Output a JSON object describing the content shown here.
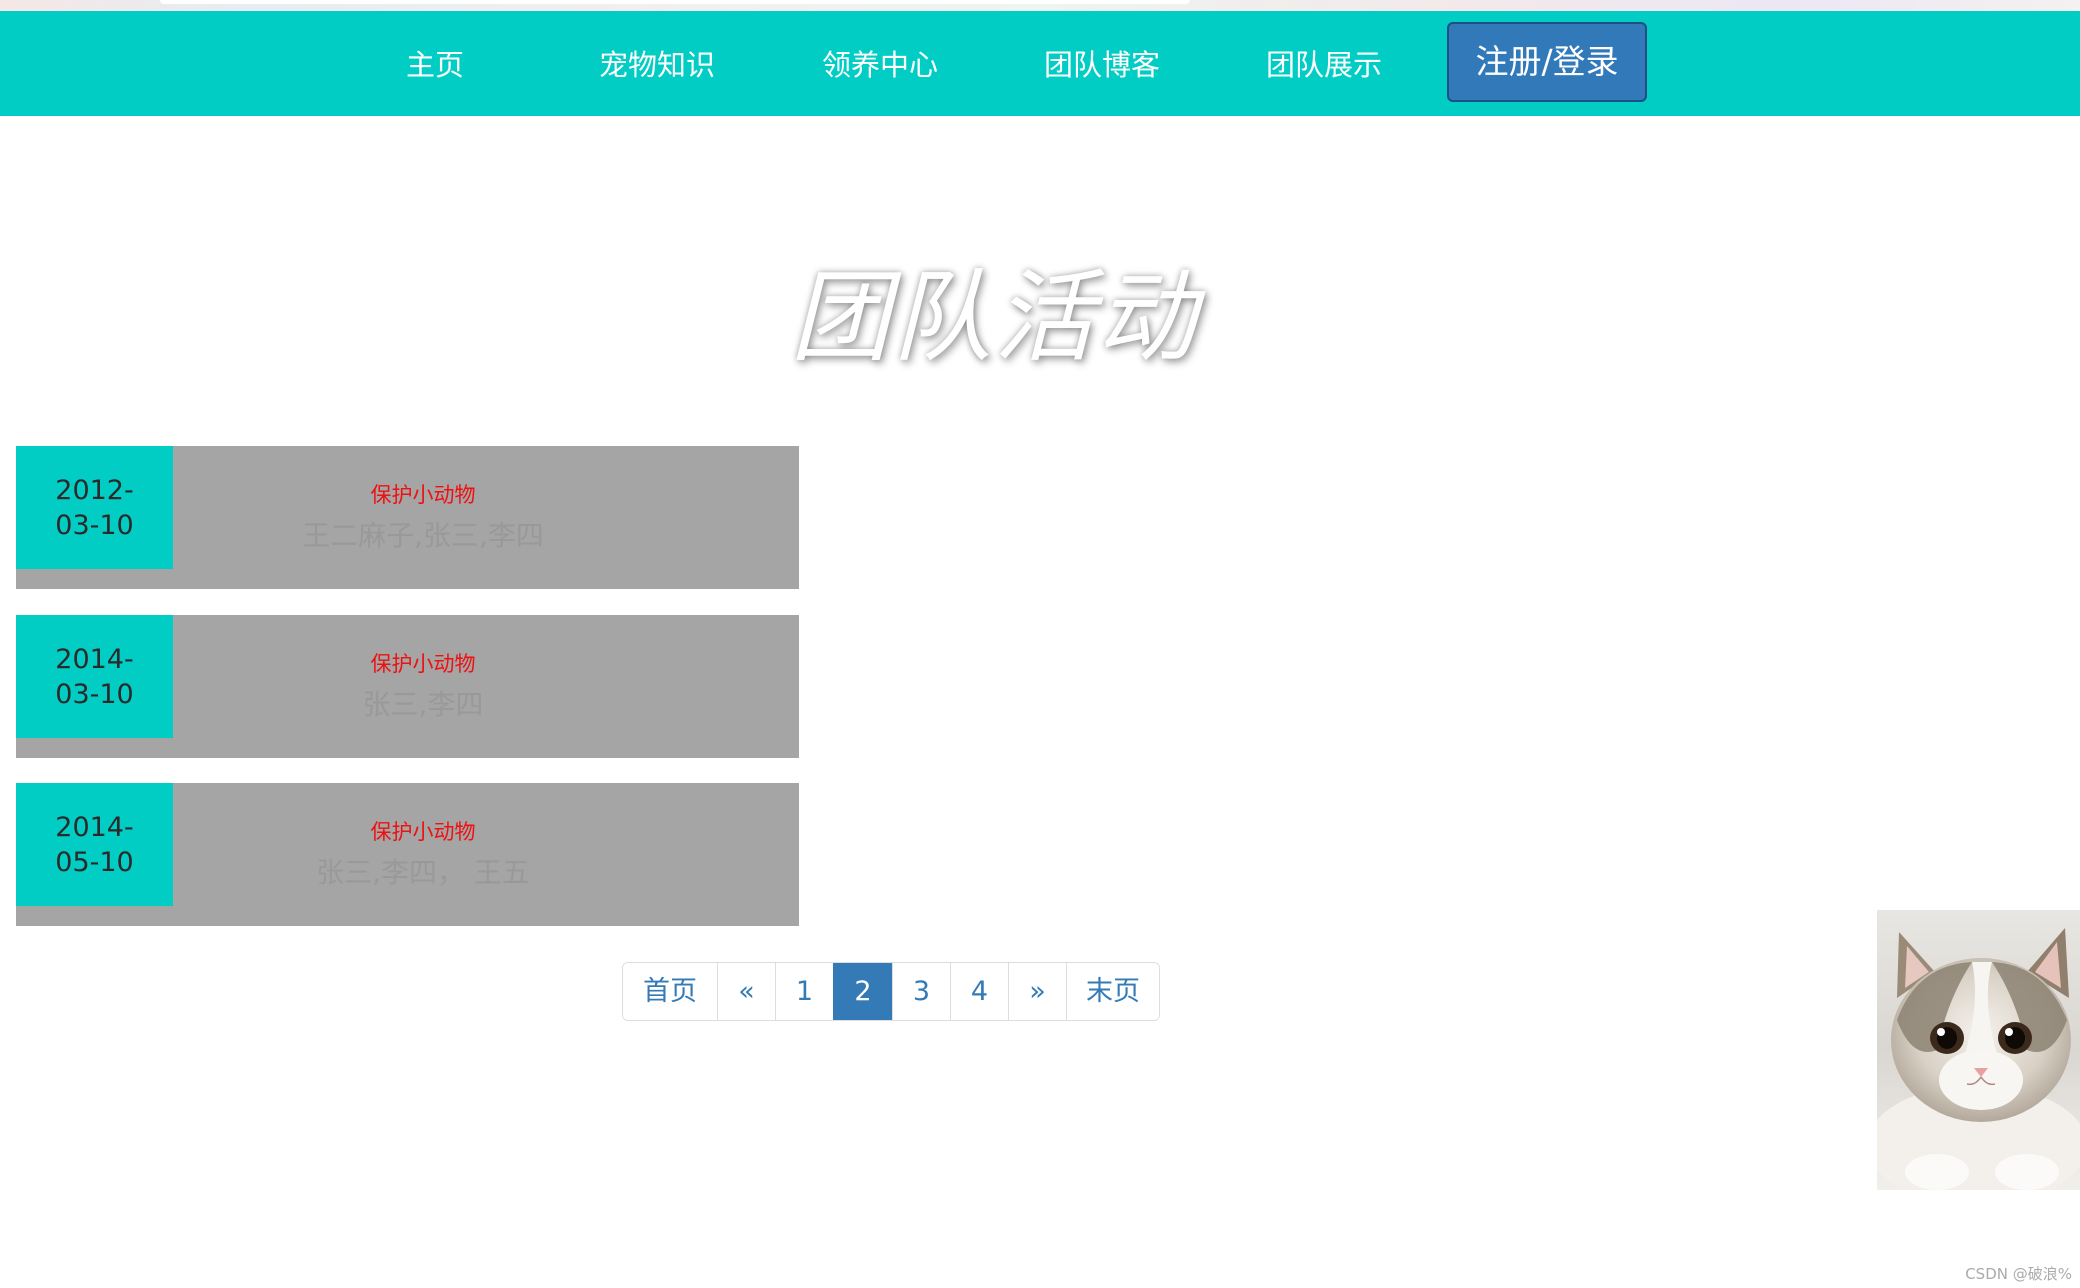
{
  "nav": {
    "items": [
      {
        "label": "主页"
      },
      {
        "label": "宠物知识"
      },
      {
        "label": "领养中心"
      },
      {
        "label": "团队博客"
      },
      {
        "label": "团队展示"
      }
    ],
    "login_label": "注册/登录"
  },
  "page_title": "团队活动",
  "activities": [
    {
      "date_part1": "2012-",
      "date_part2": "03-10",
      "title": "保护小动物",
      "members": "王二麻子,张三,李四"
    },
    {
      "date_part1": "2014-",
      "date_part2": "03-10",
      "title": "保护小动物",
      "members": "张三,李四"
    },
    {
      "date_part1": "2014-",
      "date_part2": "05-10",
      "title": "保护小动物",
      "members": "张三,李四， 王五"
    }
  ],
  "pagination": {
    "first": "首页",
    "prev": "«",
    "pages": [
      "1",
      "2",
      "3",
      "4"
    ],
    "current": "2",
    "next": "»",
    "last": "末页"
  },
  "watermark": "CSDN @破浪%",
  "colors": {
    "accent": "#02cdc4",
    "login_button": "#3279b9",
    "activity_bg": "#a5a5a5",
    "activity_title": "#ee1111",
    "pagination_active": "#337ab7"
  },
  "icons": {
    "cat_photo": "kitten-photo"
  }
}
